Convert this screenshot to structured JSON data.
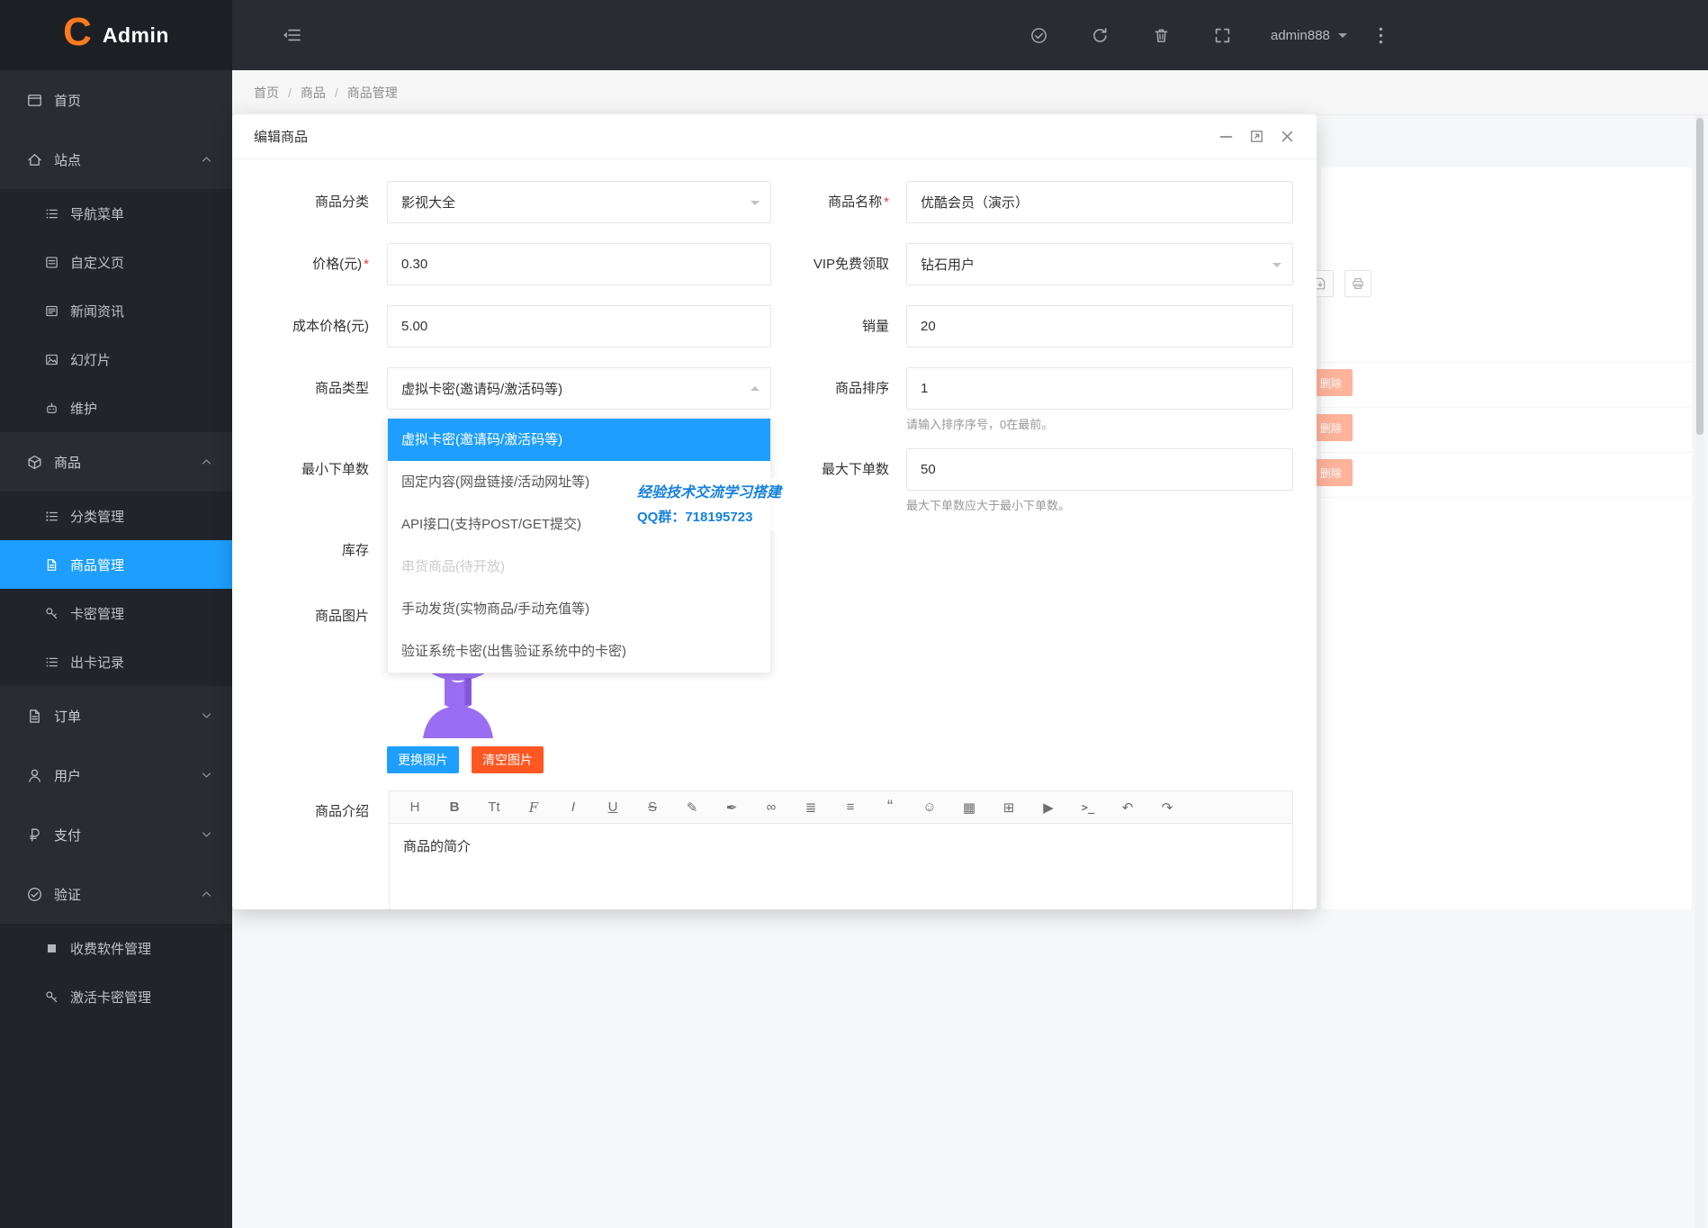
{
  "brand": {
    "logo_letter": "C",
    "app_name": "Admin"
  },
  "topbar": {
    "username": "admin888",
    "icons": [
      "collapse-menu",
      "check-circle",
      "refresh",
      "trash",
      "fullscreen",
      "more-vertical"
    ]
  },
  "sidebar": {
    "items": [
      {
        "label": "首页",
        "icon": "window"
      },
      {
        "label": "站点",
        "icon": "home",
        "chevron": "up"
      },
      {
        "label": "导航菜单",
        "icon": "list",
        "sub": true
      },
      {
        "label": "自定义页",
        "icon": "page",
        "sub": true
      },
      {
        "label": "新闻资讯",
        "icon": "news",
        "sub": true
      },
      {
        "label": "幻灯片",
        "icon": "image",
        "sub": true
      },
      {
        "label": "维护",
        "icon": "robot",
        "sub": true
      },
      {
        "label": "商品",
        "icon": "cube",
        "chevron": "up"
      },
      {
        "label": "分类管理",
        "icon": "ordered-list",
        "sub": true
      },
      {
        "label": "商品管理",
        "icon": "document",
        "sub": true,
        "active": true
      },
      {
        "label": "卡密管理",
        "icon": "key",
        "sub": true
      },
      {
        "label": "出卡记录",
        "icon": "list",
        "sub": true
      },
      {
        "label": "订单",
        "icon": "document",
        "chevron": "down"
      },
      {
        "label": "用户",
        "icon": "user",
        "chevron": "down"
      },
      {
        "label": "支付",
        "icon": "pay",
        "chevron": "down"
      },
      {
        "label": "验证",
        "icon": "check-circle",
        "chevron": "up"
      },
      {
        "label": "收费软件管理",
        "icon": "square",
        "sub": true
      },
      {
        "label": "激活卡密管理",
        "icon": "key",
        "sub": true
      }
    ]
  },
  "breadcrumb": {
    "items": [
      "首页",
      "商品",
      "商品管理"
    ],
    "separator": "/"
  },
  "modal": {
    "title": "编辑商品",
    "required_mark": "*",
    "form": {
      "category": {
        "label": "商品分类",
        "value": "影视大全"
      },
      "name": {
        "label": "商品名称",
        "required": true,
        "value": "优酷会员（演示）"
      },
      "price": {
        "label": "价格(元)",
        "required": true,
        "value": "0.30"
      },
      "vip": {
        "label": "VIP免费领取",
        "value": "钻石用户"
      },
      "cost": {
        "label": "成本价格(元)",
        "value": "5.00"
      },
      "sales": {
        "label": "销量",
        "value": "20"
      },
      "type": {
        "label": "商品类型",
        "value": "虚拟卡密(邀请码/激活码等)"
      },
      "sort": {
        "label": "商品排序",
        "value": "1",
        "hint": "请输入排序序号，0在最前。"
      },
      "min_qty": {
        "label": "最小下单数",
        "value": ""
      },
      "max_qty": {
        "label": "最大下单数",
        "value": "50",
        "hint": "最大下单数应大于最小下单数。"
      },
      "stock": {
        "label": "库存",
        "value": ""
      },
      "image": {
        "label": "商品图片",
        "change_btn": "更换图片",
        "clear_btn": "清空图片"
      },
      "intro": {
        "label": "商品介绍",
        "content": "商品的简介"
      }
    },
    "type_options": [
      {
        "label": "虚拟卡密(邀请码/激活码等)",
        "state": "selected"
      },
      {
        "label": "固定内容(网盘链接/活动网址等)",
        "state": "normal"
      },
      {
        "label": "API接口(支持POST/GET提交)",
        "state": "normal"
      },
      {
        "label": "串货商品(待开放)",
        "state": "disabled"
      },
      {
        "label": "手动发货(实物商品/手动充值等)",
        "state": "normal"
      },
      {
        "label": "验证系统卡密(出售验证系统中的卡密)",
        "state": "normal"
      }
    ],
    "editor_tools": [
      {
        "name": "heading",
        "glyph": "H"
      },
      {
        "name": "bold",
        "glyph": "B"
      },
      {
        "name": "font-size",
        "glyph": "Tt"
      },
      {
        "name": "font-family",
        "glyph": "F"
      },
      {
        "name": "italic",
        "glyph": "I"
      },
      {
        "name": "underline",
        "glyph": "U"
      },
      {
        "name": "strikethrough",
        "glyph": "S"
      },
      {
        "name": "attachment",
        "glyph": "✎"
      },
      {
        "name": "brush",
        "glyph": "✒"
      },
      {
        "name": "link",
        "glyph": "∞"
      },
      {
        "name": "unordered-list",
        "glyph": "≣"
      },
      {
        "name": "align",
        "glyph": "≡"
      },
      {
        "name": "quote",
        "glyph": "“"
      },
      {
        "name": "emoji",
        "glyph": "☺"
      },
      {
        "name": "image",
        "glyph": "▦"
      },
      {
        "name": "table",
        "glyph": "⊞"
      },
      {
        "name": "video",
        "glyph": "▶"
      },
      {
        "name": "code",
        "glyph": ">_"
      },
      {
        "name": "undo",
        "glyph": "↶"
      },
      {
        "name": "redo",
        "glyph": "↷"
      }
    ]
  },
  "watermark": {
    "line1": "经验技术交流学习搭建",
    "line2": "QQ群：718195723"
  },
  "background": {
    "delete_label": "删除",
    "tool_icons": [
      "export",
      "print"
    ]
  },
  "colors": {
    "accent": "#1E9FFF",
    "danger": "#FF5722",
    "logo_orange": "#ff7a1e",
    "selected_option_bg": "#1E9FFF"
  }
}
